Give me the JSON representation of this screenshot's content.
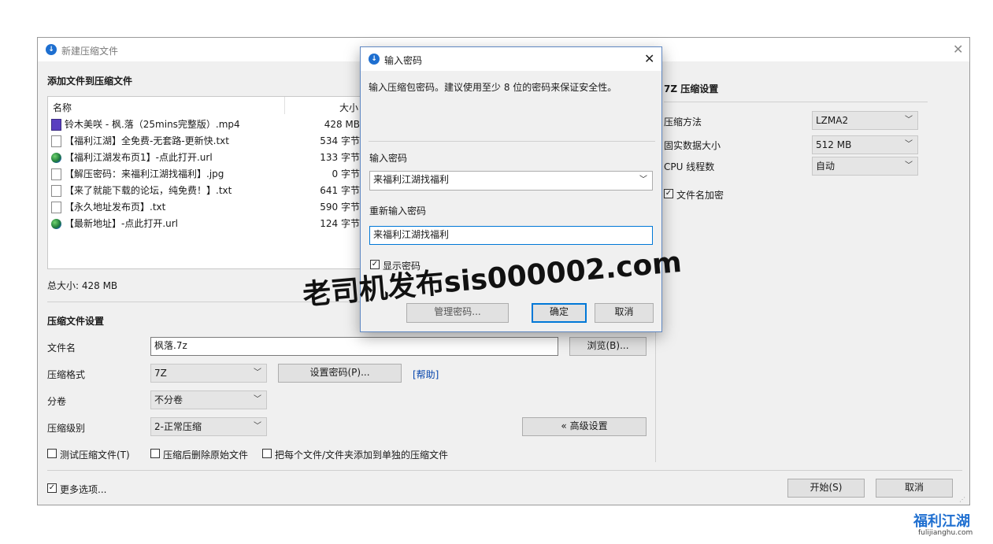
{
  "main_window": {
    "title": "新建压缩文件",
    "add_files_title": "添加文件到压缩文件",
    "columns": {
      "name": "名称",
      "size": "大小"
    },
    "files": [
      {
        "name": "铃木美咲 - 枫.落（25mins完整版）.mp4",
        "size": "428 MB",
        "icon": "video-file-icon"
      },
      {
        "name": "【福利江湖】全免费-无套路-更新快.txt",
        "size": "534 字节",
        "icon": "text-file-icon"
      },
      {
        "name": "【福利江湖发布页1】-点此打开.url",
        "size": "133 字节",
        "icon": "globe-icon"
      },
      {
        "name": "【解压密码：来福利江湖找福利】.jpg",
        "size": "0 字节",
        "icon": "text-file-icon"
      },
      {
        "name": "【来了就能下载的论坛，纯免费！】.txt",
        "size": "641 字节",
        "icon": "text-file-icon"
      },
      {
        "name": "【永久地址发布页】.txt",
        "size": "590 字节",
        "icon": "text-file-icon"
      },
      {
        "name": "【最新地址】-点此打开.url",
        "size": "124 字节",
        "icon": "globe-icon"
      }
    ],
    "total_size": "总大小: 428 MB",
    "settings_title": "压缩文件设置",
    "filename_label": "文件名",
    "filename_value": "枫落.7z",
    "browse_button": "浏览(B)...",
    "format_label": "压缩格式",
    "format_value": "7Z",
    "set_password_button": "设置密码(P)...",
    "help_link": "[帮助]",
    "split_label": "分卷",
    "split_value": "不分卷",
    "level_label": "压缩级别",
    "level_value": "2-正常压缩",
    "advanced_button": "« 高级设置",
    "test_checkbox": "测试压缩文件(T)",
    "delete_checkbox": "压缩后删除原始文件",
    "separate_checkbox": "把每个文件/文件夹添加到单独的压缩文件",
    "more_options": "更多选项...",
    "start_button": "开始(S)",
    "cancel_button": "取消"
  },
  "right_panel": {
    "title": "7Z 压缩设置",
    "method_label": "压缩方法",
    "method_value": "LZMA2",
    "block_label": "固实数据大小",
    "block_value": "512 MB",
    "cpu_label": "CPU 线程数",
    "cpu_value": "自动",
    "encrypt_names": "文件名加密",
    "encrypt_names_checked": true
  },
  "dialog": {
    "title": "输入密码",
    "instruction": "输入压缩包密码。建议使用至少 8 位的密码来保证安全性。",
    "password_label": "输入密码",
    "password_value": "来福利江湖找福利",
    "reenter_label": "重新输入密码",
    "reenter_value": "来福利江湖找福利",
    "show_password": "显示密码",
    "show_password_checked": true,
    "hidden_button": "管理密码...",
    "ok_button": "确定",
    "cancel_button": "取消"
  },
  "overlay": {
    "watermark": "老司机发布sis000002.com",
    "logo_text": "福利江湖",
    "logo_url": "fulijianghu.com"
  },
  "colors": {
    "accent": "#0078d7",
    "link": "#0645ad",
    "app_icon": "#1e6fd0"
  }
}
